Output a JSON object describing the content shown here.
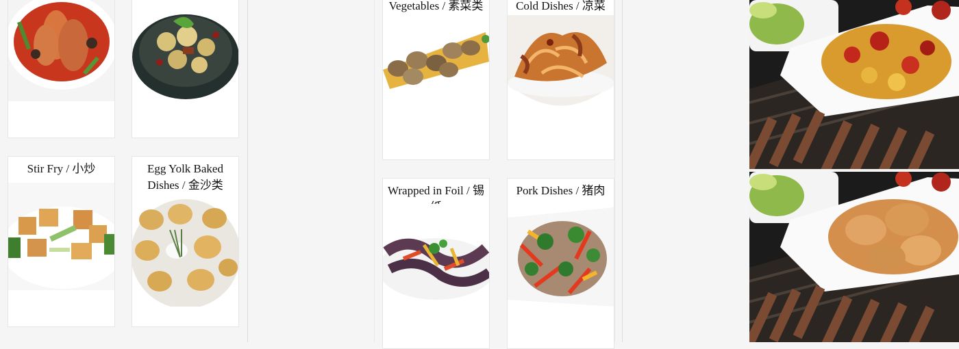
{
  "left_column": {
    "cards": [
      {
        "id": "fish",
        "label": ""
      },
      {
        "id": "cauliflower",
        "label": ""
      },
      {
        "id": "stir-fry",
        "label": "Stir Fry / 小炒"
      },
      {
        "id": "egg-yolk",
        "label": "Egg Yolk Baked Dishes / 金沙类"
      }
    ]
  },
  "middle_column": {
    "cards": [
      {
        "id": "vegetables",
        "label": "Vegetables / 素菜类"
      },
      {
        "id": "cold",
        "label": "Cold Dishes / 凉菜"
      },
      {
        "id": "foil",
        "label": "Wrapped in Foil / 锡纸"
      },
      {
        "id": "pork",
        "label": "Pork Dishes / 猪肉"
      }
    ]
  },
  "right_banner": {
    "images": [
      "spicy-chicken-and-skewers",
      "fried-chicken-and-skewers"
    ]
  }
}
